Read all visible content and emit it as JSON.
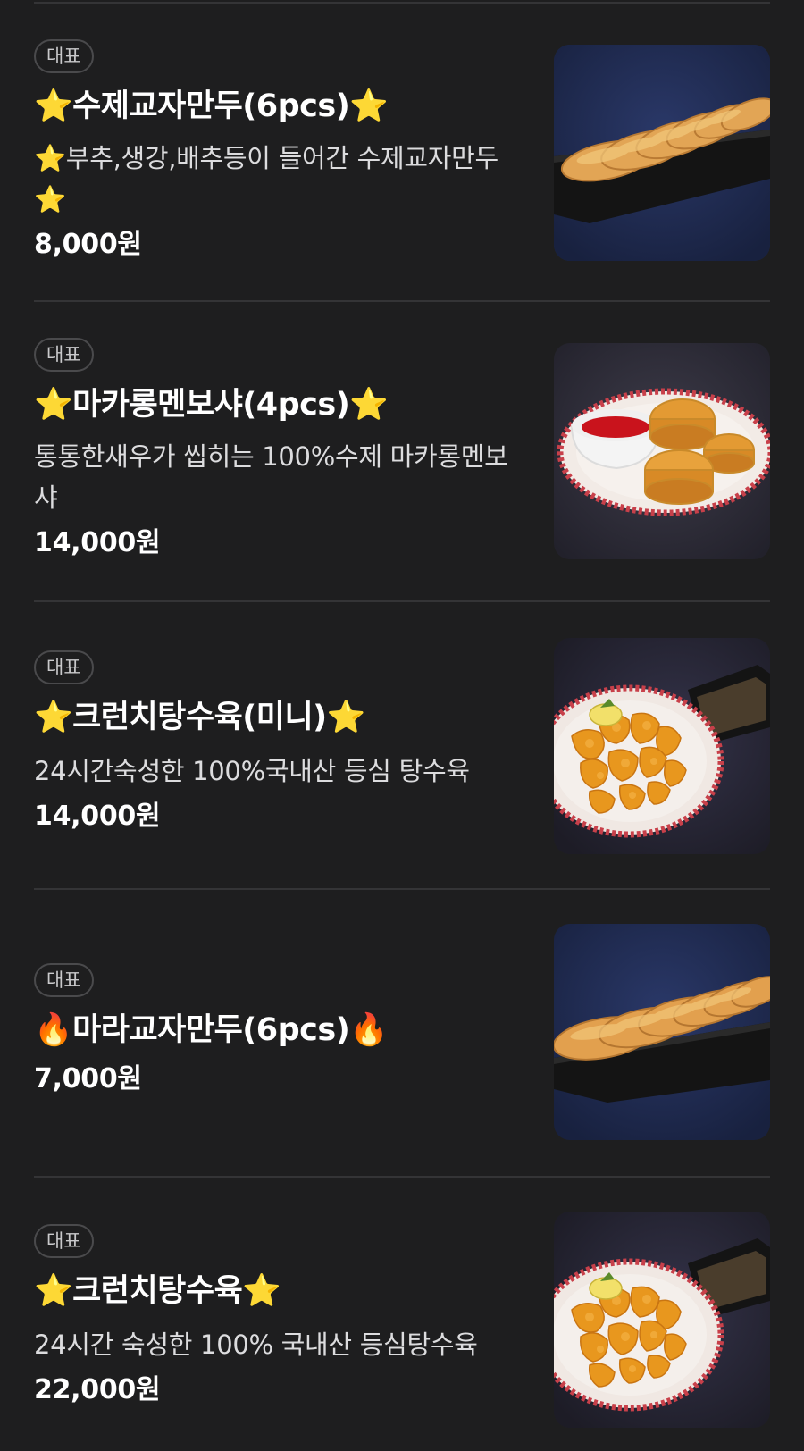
{
  "menu": {
    "items": [
      {
        "badge": "대표",
        "title": "⭐수제교자만두(6pcs)⭐",
        "desc": "⭐부추,생강,배추등이 들어간 수제교자만두⭐",
        "price": "8,000원",
        "image_icon": "dumplings-on-plate"
      },
      {
        "badge": "대표",
        "title": "⭐마카롱멘보샤(4pcs)⭐",
        "desc": "통통한새우가 씹히는 100%수제 마카롱멘보샤",
        "price": "14,000원",
        "image_icon": "menbosha-with-sauce"
      },
      {
        "badge": "대표",
        "title": "⭐크런치탕수육(미니)⭐",
        "desc": "24시간숙성한 100%국내산 등심 탕수육",
        "price": "14,000원",
        "image_icon": "sweet-sour-pork"
      },
      {
        "badge": "대표",
        "title": "🔥마라교자만두(6pcs)🔥",
        "desc": "",
        "price": "7,000원",
        "image_icon": "dumplings-on-plate"
      },
      {
        "badge": "대표",
        "title": "⭐크런치탕수육⭐",
        "desc": "24시간 숙성한 100% 국내산 등심탕수육",
        "price": "22,000원",
        "image_icon": "sweet-sour-pork"
      }
    ]
  }
}
